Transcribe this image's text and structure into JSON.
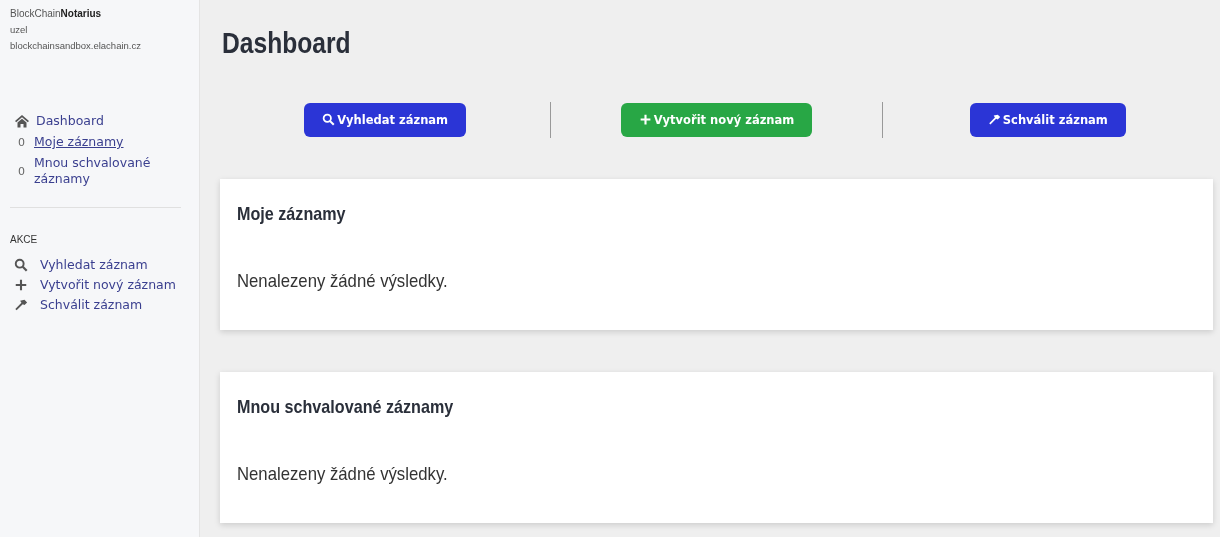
{
  "sidebar": {
    "brand": {
      "light": "BlockChain",
      "bold": "Notarius"
    },
    "node_label": "uzel",
    "host": "blockchainsandbox.elachain.cz",
    "nav": [
      {
        "kind": "home",
        "label": "Dashboard",
        "selected": false
      },
      {
        "kind": "count",
        "count": "0",
        "label": "Moje záznamy",
        "selected": true
      },
      {
        "kind": "count",
        "count": "0",
        "label": "Mnou schvalované záznamy",
        "selected": false
      }
    ],
    "actions_heading": "AKCE",
    "actions": [
      {
        "kind": "search",
        "label": "Vyhledat záznam"
      },
      {
        "kind": "plus",
        "label": "Vytvořit nový záznam"
      },
      {
        "kind": "hammer",
        "label": "Schválit záznam"
      }
    ]
  },
  "page": {
    "title": "Dashboard",
    "buttons": [
      {
        "kind": "search",
        "label": "Vyhledat záznam",
        "color": "#2b35d6"
      },
      {
        "kind": "plus",
        "label": "Vytvořit nový záznam",
        "color": "#28a745"
      },
      {
        "kind": "hammer",
        "label": "Schválit záznam",
        "color": "#2b35d6"
      }
    ],
    "cards": [
      {
        "title": "Moje záznamy",
        "message": "Nenalezeny žádné výsledky."
      },
      {
        "title": "Mnou schvalované záznamy",
        "message": "Nenalezeny žádné výsledky."
      }
    ]
  }
}
